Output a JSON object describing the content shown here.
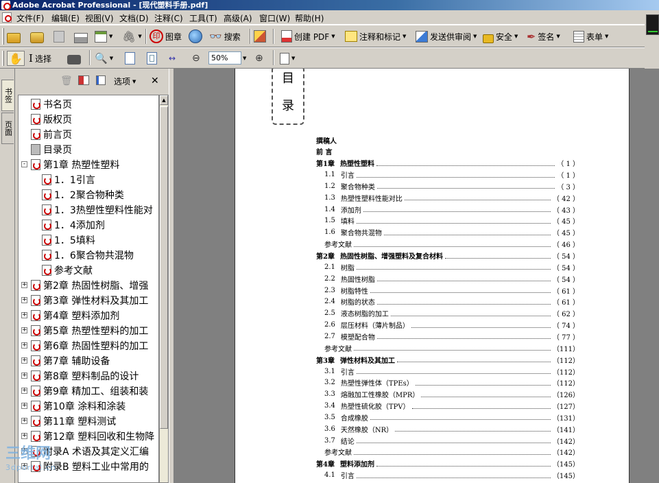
{
  "window": {
    "title": "Adobe Acrobat Professional - [现代塑料手册.pdf]"
  },
  "menu": [
    "文件(F)",
    "编辑(E)",
    "视图(V)",
    "文档(D)",
    "注释(C)",
    "工具(T)",
    "高级(A)",
    "窗口(W)",
    "帮助(H)"
  ],
  "toolbar1": {
    "stamp": "图章",
    "search": "搜索",
    "create_pdf": "创建 PDF",
    "comment": "注释和标记",
    "send_review": "发送供审阅",
    "security": "安全",
    "sign": "签名",
    "forms": "表单"
  },
  "toolbar2": {
    "select_label": "选择",
    "zoom_value": "50%"
  },
  "side_tabs": [
    "书签",
    "页面"
  ],
  "panel": {
    "options_label": "选项"
  },
  "bookmarks": [
    {
      "label": "书名页",
      "icon": "pdf",
      "level": 0,
      "expander": ""
    },
    {
      "label": "版权页",
      "icon": "pdf",
      "level": 0,
      "expander": ""
    },
    {
      "label": "前言页",
      "icon": "pdf",
      "level": 0,
      "expander": ""
    },
    {
      "label": "目录页",
      "icon": "gray",
      "level": 0,
      "expander": ""
    },
    {
      "label": "第1章 热塑性塑料",
      "icon": "pdf",
      "level": 0,
      "expander": "-"
    },
    {
      "label": "1．1引言",
      "icon": "pdf",
      "level": 1,
      "expander": ""
    },
    {
      "label": "1．2聚合物种类",
      "icon": "pdf",
      "level": 1,
      "expander": ""
    },
    {
      "label": "1．3热塑性塑料性能对",
      "icon": "pdf",
      "level": 1,
      "expander": ""
    },
    {
      "label": "1．4添加剂",
      "icon": "pdf",
      "level": 1,
      "expander": ""
    },
    {
      "label": "1．5填料",
      "icon": "pdf",
      "level": 1,
      "expander": ""
    },
    {
      "label": "1．6聚合物共混物",
      "icon": "pdf",
      "level": 1,
      "expander": ""
    },
    {
      "label": "参考文献",
      "icon": "pdf",
      "level": 1,
      "expander": ""
    },
    {
      "label": "第2章 热固性树脂、增强",
      "icon": "pdf",
      "level": 0,
      "expander": "+"
    },
    {
      "label": "第3章 弹性材料及其加工",
      "icon": "pdf",
      "level": 0,
      "expander": "+"
    },
    {
      "label": "第4章 塑料添加剂",
      "icon": "pdf",
      "level": 0,
      "expander": "+"
    },
    {
      "label": "第5章 热塑性塑料的加工",
      "icon": "pdf",
      "level": 0,
      "expander": "+"
    },
    {
      "label": "第6章 热固性塑料的加工",
      "icon": "pdf",
      "level": 0,
      "expander": "+"
    },
    {
      "label": "第7章 辅助设备",
      "icon": "pdf",
      "level": 0,
      "expander": "+"
    },
    {
      "label": "第8章 塑料制品的设计",
      "icon": "pdf",
      "level": 0,
      "expander": "+"
    },
    {
      "label": "第9章 精加工、组装和装",
      "icon": "pdf",
      "level": 0,
      "expander": "+"
    },
    {
      "label": "第10章 涂料和涂装",
      "icon": "pdf",
      "level": 0,
      "expander": "+"
    },
    {
      "label": "第11章 塑料测试",
      "icon": "pdf",
      "level": 0,
      "expander": "+"
    },
    {
      "label": "第12章 塑料回收和生物降",
      "icon": "pdf",
      "level": 0,
      "expander": "+"
    },
    {
      "label": "附录A 术语及其定义汇编",
      "icon": "pdf",
      "level": 0,
      "expander": "+"
    },
    {
      "label": "附录B 塑料工业中常用的",
      "icon": "pdf",
      "level": 0,
      "expander": "+"
    }
  ],
  "document": {
    "heading_chars": [
      "目",
      "录"
    ],
    "toc": [
      {
        "num": "",
        "title": "撰稿人",
        "page": "",
        "kind": "bold"
      },
      {
        "num": "",
        "title": "前 言",
        "page": "",
        "kind": "bold"
      },
      {
        "num": "第1章",
        "title": "热塑性塑料",
        "page": "（ 1 ）",
        "kind": "chapter"
      },
      {
        "num": "1.1",
        "title": "引言",
        "page": "（ 1 ）",
        "kind": "sec"
      },
      {
        "num": "1.2",
        "title": "聚合物种类",
        "page": "（ 3 ）",
        "kind": "sec"
      },
      {
        "num": "1.3",
        "title": "热塑性塑料性能对比",
        "page": "（ 42 ）",
        "kind": "sec"
      },
      {
        "num": "1.4",
        "title": "添加剂",
        "page": "（ 43 ）",
        "kind": "sec"
      },
      {
        "num": "1.5",
        "title": "填料",
        "page": "（ 45 ）",
        "kind": "sec"
      },
      {
        "num": "1.6",
        "title": "聚合物共混物",
        "page": "（ 45 ）",
        "kind": "sec"
      },
      {
        "num": "",
        "title": "参考文献",
        "page": "（ 46 ）",
        "kind": "sec"
      },
      {
        "num": "第2章",
        "title": "热固性树脂、增强塑料及复合材料",
        "page": "（ 54 ）",
        "kind": "chapter"
      },
      {
        "num": "2.1",
        "title": "树脂",
        "page": "（ 54 ）",
        "kind": "sec"
      },
      {
        "num": "2.2",
        "title": "热固性树脂",
        "page": "（ 54 ）",
        "kind": "sec"
      },
      {
        "num": "2.3",
        "title": "树脂特性",
        "page": "（ 61 ）",
        "kind": "sec"
      },
      {
        "num": "2.4",
        "title": "树脂的状态",
        "page": "（ 61 ）",
        "kind": "sec"
      },
      {
        "num": "2.5",
        "title": "液态树脂的加工",
        "page": "（ 62 ）",
        "kind": "sec"
      },
      {
        "num": "2.6",
        "title": "层压材料（薄片制品）",
        "page": "（ 74 ）",
        "kind": "sec"
      },
      {
        "num": "2.7",
        "title": "模塑配合物",
        "page": "（ 77 ）",
        "kind": "sec"
      },
      {
        "num": "",
        "title": "参考文献",
        "page": "（111）",
        "kind": "sec"
      },
      {
        "num": "第3章",
        "title": "弹性材料及其加工",
        "page": "（112）",
        "kind": "chapter"
      },
      {
        "num": "3.1",
        "title": "引言",
        "page": "（112）",
        "kind": "sec"
      },
      {
        "num": "3.2",
        "title": "热塑性弹性体（TPEs）",
        "page": "（112）",
        "kind": "sec"
      },
      {
        "num": "3.3",
        "title": "熔融加工性橡胶（MPR）",
        "page": "（126）",
        "kind": "sec"
      },
      {
        "num": "3.4",
        "title": "热塑性硫化胶（TPV）",
        "page": "（127）",
        "kind": "sec"
      },
      {
        "num": "3.5",
        "title": "合成橡胶",
        "page": "（131）",
        "kind": "sec"
      },
      {
        "num": "3.6",
        "title": "天然橡胶（NR）",
        "page": "（141）",
        "kind": "sec"
      },
      {
        "num": "3.7",
        "title": "结论",
        "page": "（142）",
        "kind": "sec"
      },
      {
        "num": "",
        "title": "参考文献",
        "page": "（142）",
        "kind": "sec"
      },
      {
        "num": "第4章",
        "title": "塑料添加剂",
        "page": "（145）",
        "kind": "chapter"
      },
      {
        "num": "4.1",
        "title": "引言",
        "page": "（145）",
        "kind": "sec"
      }
    ]
  },
  "watermark": {
    "brand": "三维网",
    "sub": "3dportal.cn"
  }
}
